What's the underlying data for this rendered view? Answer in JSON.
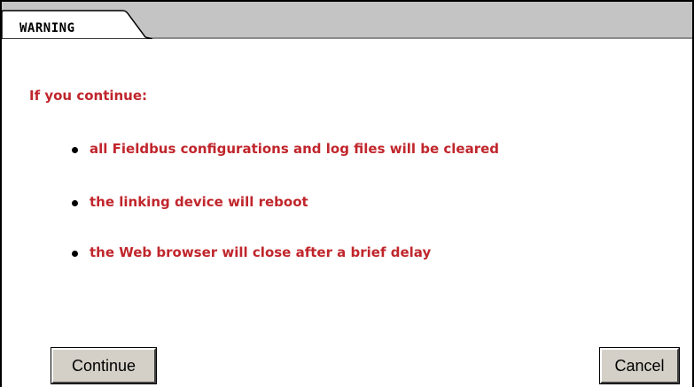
{
  "tab": {
    "label": "WARNING"
  },
  "message": {
    "intro": "If you continue:",
    "bullets": [
      "all Fieldbus configurations and log files will be cleared",
      "the linking device will reboot",
      "the Web browser will close after a brief delay"
    ]
  },
  "buttons": {
    "continue_label": "Continue",
    "cancel_label": "Cancel"
  },
  "colors": {
    "warning_text": "#c0262c",
    "tab_strip": "#c4c4c4",
    "button_face": "#d4d0c8"
  }
}
